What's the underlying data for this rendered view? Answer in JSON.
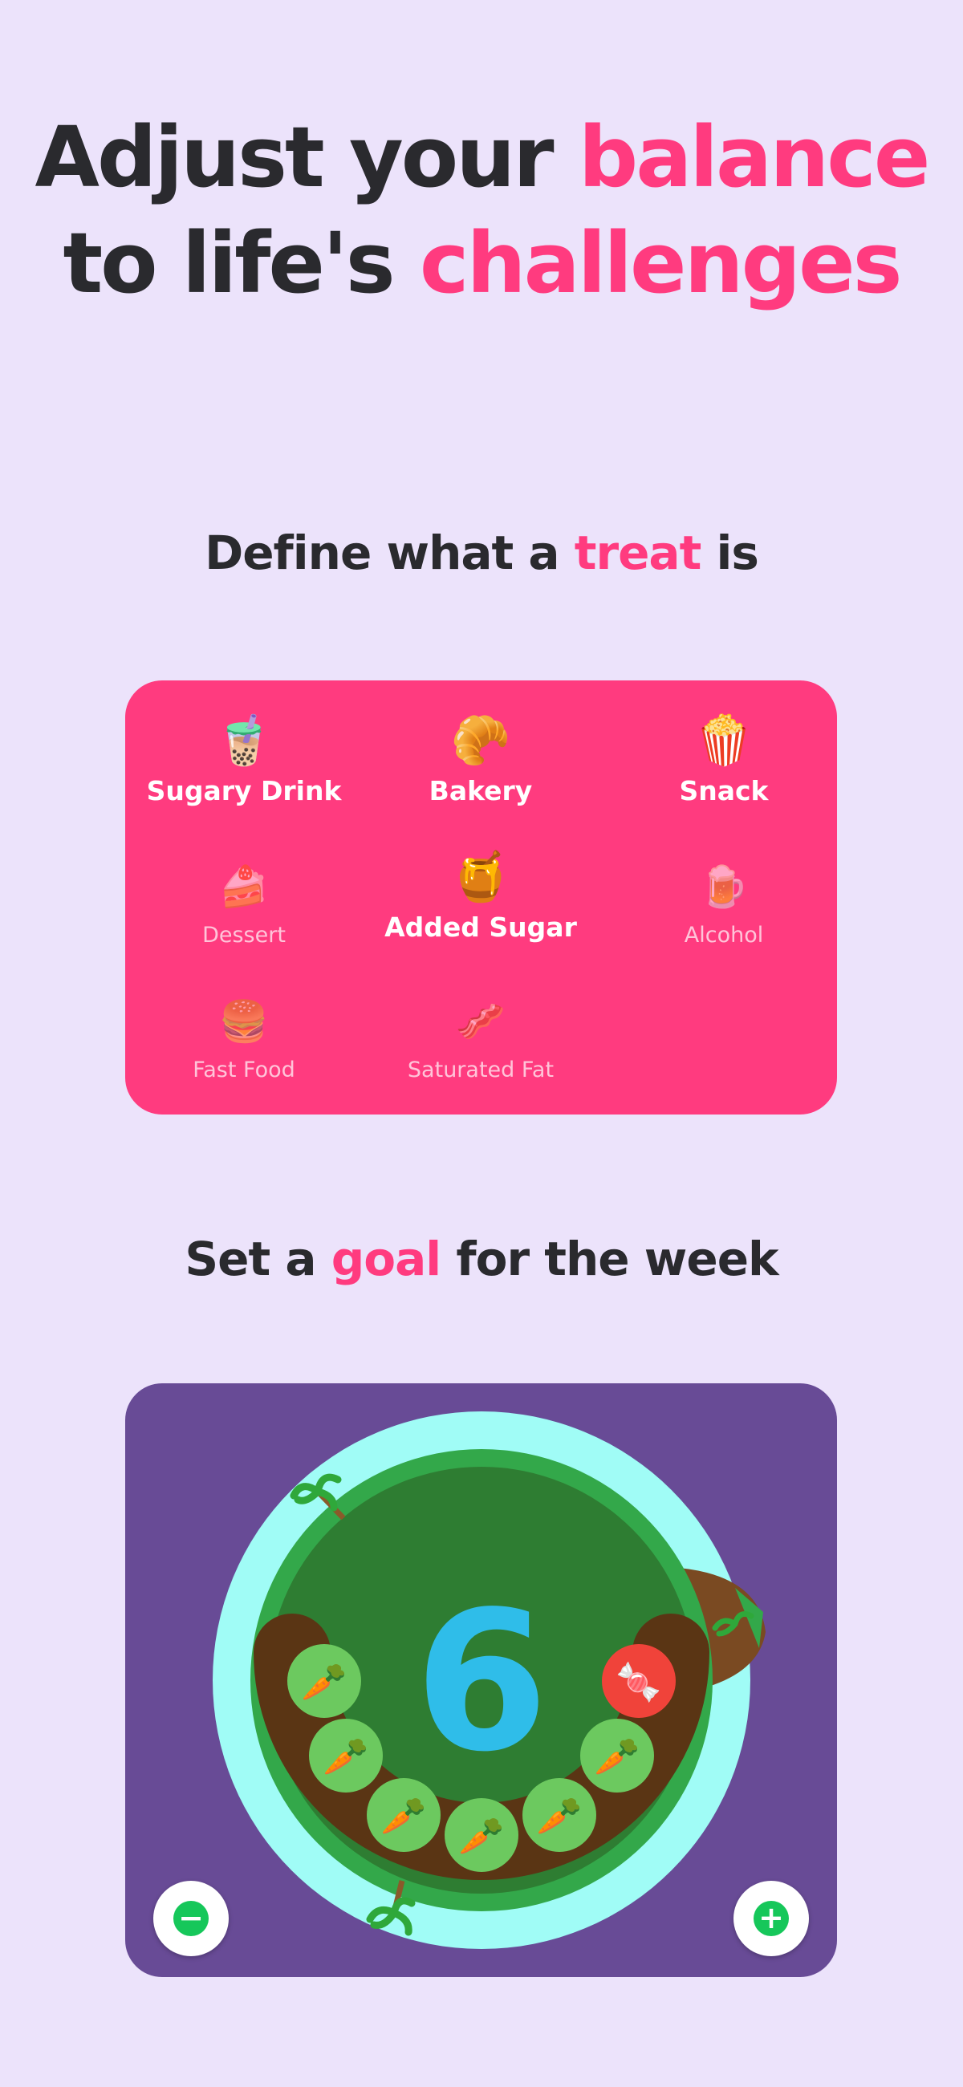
{
  "headline": {
    "line1_prefix": "Adjust your",
    "line1_highlight": "balance",
    "line2_prefix": "to life's",
    "line2_highlight": "challenges"
  },
  "treat_section": {
    "title_prefix": "Define what a",
    "title_highlight": "treat",
    "title_suffix": "is",
    "items": [
      {
        "emoji": "🧋",
        "label": "Sugary Drink",
        "selected": true
      },
      {
        "emoji": "🥐",
        "label": "Bakery",
        "selected": true
      },
      {
        "emoji": "🍿",
        "label": "Snack",
        "selected": true
      },
      {
        "emoji": "🍰",
        "label": "Dessert",
        "selected": false
      },
      {
        "emoji": "🍯",
        "label": "Added Sugar",
        "selected": true
      },
      {
        "emoji": "🍺",
        "label": "Alcohol",
        "selected": false
      },
      {
        "emoji": "🍔",
        "label": "Fast Food",
        "selected": false
      },
      {
        "emoji": "🥓",
        "label": "Saturated Fat",
        "selected": false
      }
    ]
  },
  "goal_section": {
    "title_prefix": "Set a",
    "title_highlight": "goal",
    "title_suffix": "for the week",
    "goal_value": "6",
    "slots": [
      "🥕",
      "🥕",
      "🥕",
      "🥕",
      "🥕",
      "🥕",
      "🍬"
    ],
    "decrease_label": "−",
    "increase_label": "+",
    "colors": {
      "card_bg": "#684b96",
      "water": "#a0fcf6",
      "island_outer": "#33a84a",
      "island_inner": "#2e7d32",
      "soil": "#5a3514",
      "goal_number": "#2fbde9",
      "carrot_slot": "#6cc95f",
      "treat_slot": "#f0433a",
      "button_accent": "#16c75a"
    }
  }
}
